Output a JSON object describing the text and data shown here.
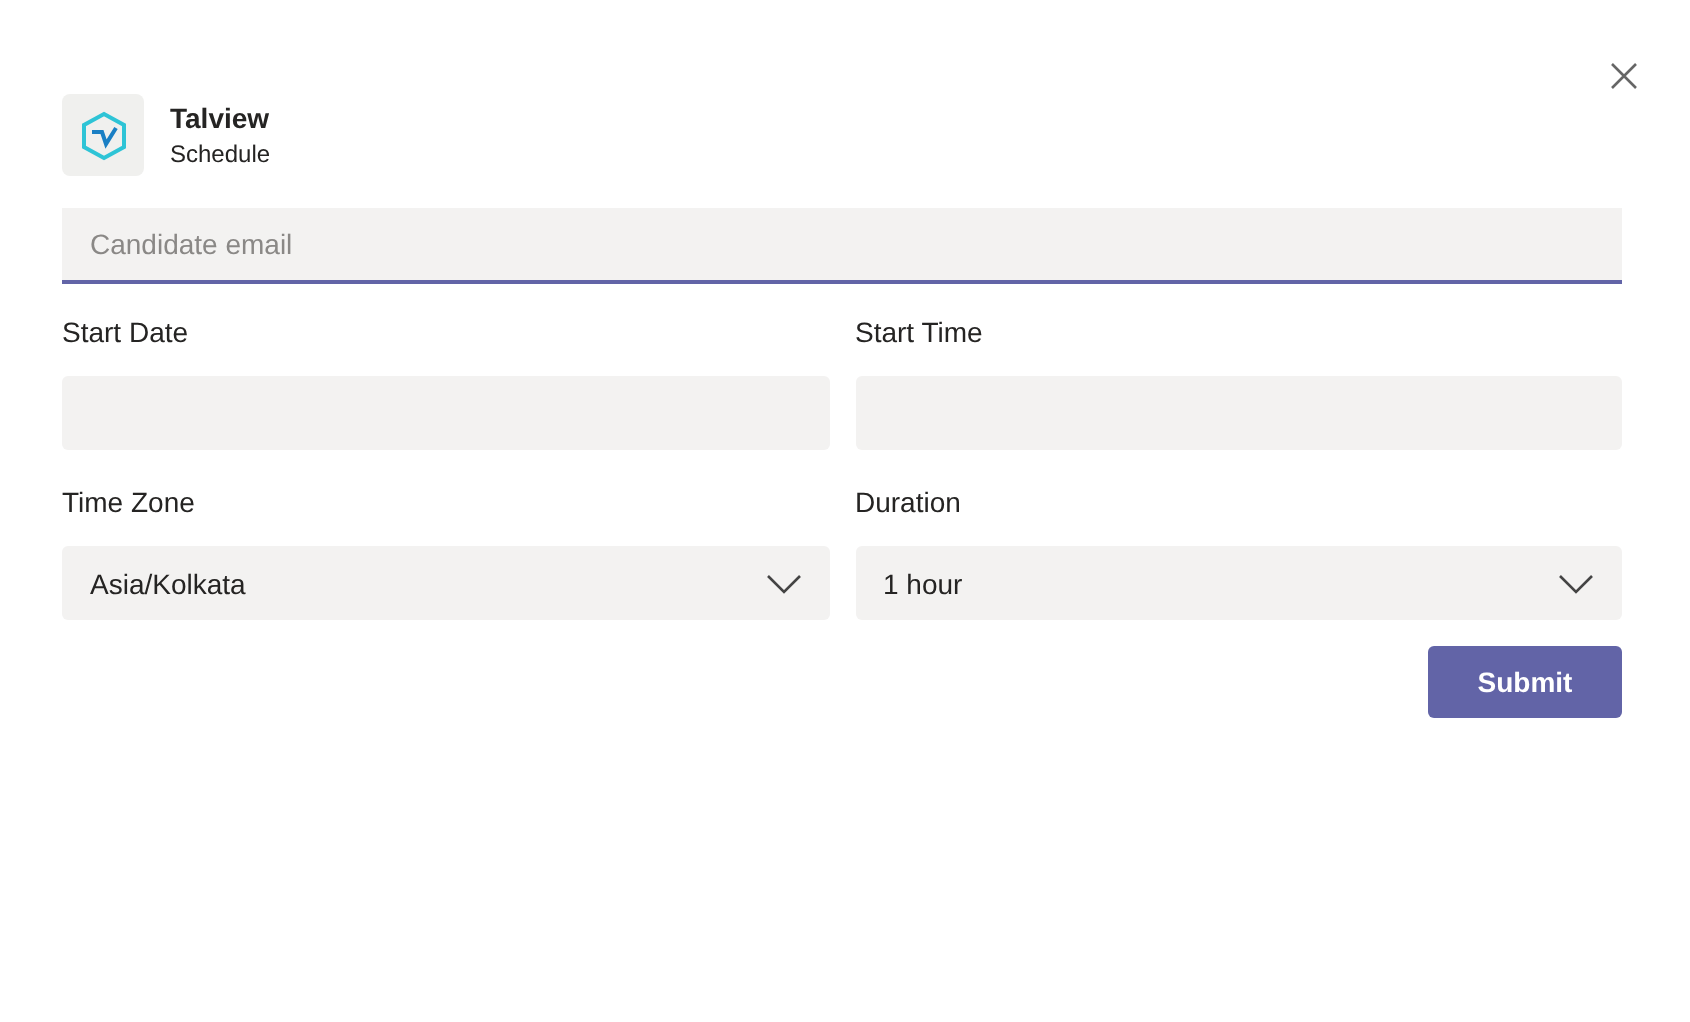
{
  "app": {
    "name": "Talview",
    "subtitle": "Schedule"
  },
  "email": {
    "placeholder": "Candidate email"
  },
  "fields": [
    {
      "label": "Start Date",
      "kind": "text"
    },
    {
      "label": "Start Time",
      "kind": "text"
    },
    {
      "label": "Time Zone",
      "kind": "select",
      "value": "Asia/Kolkata"
    },
    {
      "label": "Duration",
      "kind": "select",
      "value": "1 hour"
    }
  ],
  "submit": "Submit"
}
